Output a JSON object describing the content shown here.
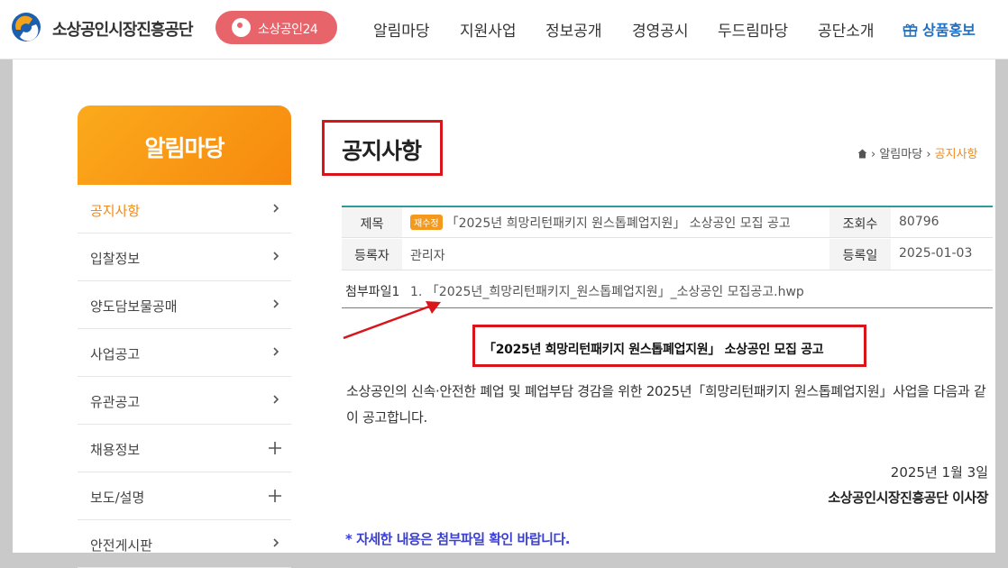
{
  "header": {
    "org_name": "소상공인시장진흥공단",
    "pill_label": "소상공인24",
    "nav": [
      "알림마당",
      "지원사업",
      "정보공개",
      "경영공시",
      "두드림마당",
      "공단소개"
    ],
    "promo_label": "상품홍보"
  },
  "sidebar": {
    "title": "알림마당",
    "items": [
      {
        "label": "공지사항",
        "icon": "chevron-right-icon"
      },
      {
        "label": "입찰정보",
        "icon": "chevron-right-icon"
      },
      {
        "label": "양도담보물공매",
        "icon": "chevron-right-icon"
      },
      {
        "label": "사업공고",
        "icon": "chevron-right-icon"
      },
      {
        "label": "유관공고",
        "icon": "chevron-right-icon"
      },
      {
        "label": "채용정보",
        "icon": "plus-icon"
      },
      {
        "label": "보도/설명",
        "icon": "plus-icon"
      },
      {
        "label": "안전게시판",
        "icon": "chevron-right-icon"
      }
    ]
  },
  "page": {
    "title": "공지사항",
    "breadcrumb": {
      "parent": "알림마당",
      "current": "공지사항"
    }
  },
  "post": {
    "subject_label": "제목",
    "badge": "재수정",
    "subject": "「2025년 희망리턴패키지 원스톱폐업지원」 소상공인 모집 공고",
    "views_label": "조회수",
    "views": "80796",
    "author_label": "등록자",
    "author": "관리자",
    "date_label": "등록일",
    "date": "2025-01-03",
    "attachment_label": "첨부파일1",
    "attachment": "1. 「2025년_희망리턴패키지_원스톱폐업지원」_소상공인 모집공고.hwp",
    "headline": "「2025년 희망리턴패키지 원스톱폐업지원」 소상공인 모집 공고",
    "body": "소상공인의 신속·안전한 폐업 및 폐업부담 경감을 위한 2025년「희망리턴패키지 원스톱폐업지원」사업을 다음과 같이 공고합니다.",
    "sign_date": "2025년 1월 3일",
    "signature": "소상공인시장진흥공단 이사장",
    "note": "* 자세한 내용은 첨부파일 확인 바랍니다."
  },
  "colors": {
    "accent_orange": "#f08a1c",
    "pill_red": "#e8646b",
    "table_teal": "#2c9d96",
    "highlight_red": "#d8151a",
    "note_blue": "#3b3fd2"
  }
}
